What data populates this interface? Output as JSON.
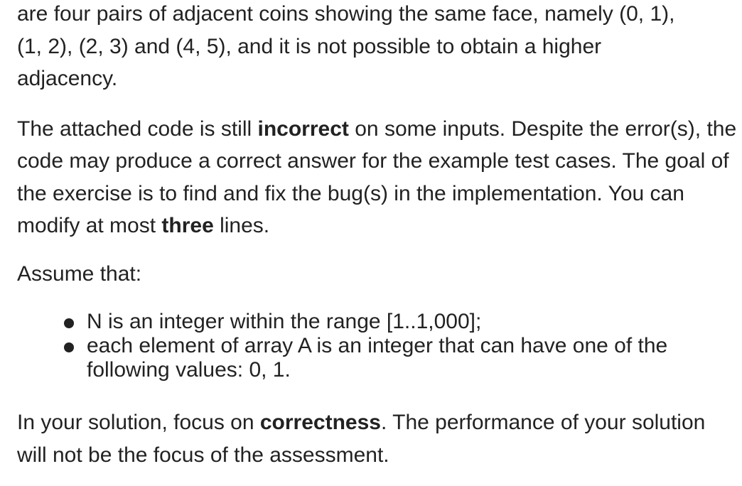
{
  "intro": {
    "line1": "are four pairs of adjacent coins showing the same face, namely (0, 1),",
    "line2": "(1, 2), (2, 3) and (4, 5), and it is not possible to obtain a higher",
    "line3": "adjacency."
  },
  "task": {
    "p1": "The attached code is still ",
    "p1_bold": "incorrect",
    "p2": " on some inputs. Despite the error(s), the code may produce a correct answer for the example test cases. The goal of the exercise is to find and fix the bug(s) in the implementation. You can modify at most ",
    "p2_bold": "three",
    "p3": " lines."
  },
  "assume": {
    "heading": "Assume that:",
    "items": [
      "N is an integer within the range [1..1,000];",
      "each element of array A is an integer that can have one of the following values: 0, 1."
    ]
  },
  "focus": {
    "p1": "In your solution, focus on ",
    "p1_bold": "correctness",
    "p2": ". The performance of your solution will not be the focus of the assessment."
  }
}
